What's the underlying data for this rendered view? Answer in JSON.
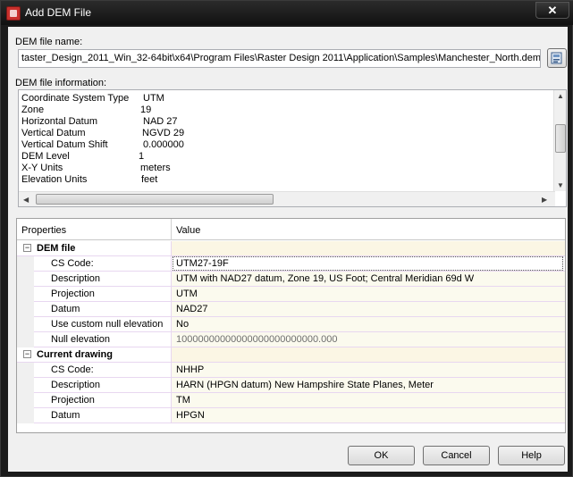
{
  "window": {
    "title": "Add DEM File",
    "close_glyph": "✕"
  },
  "dem_file_name": {
    "label": "DEM file name:",
    "value": "taster_Design_2011_Win_32-64bit\\x64\\Program Files\\Raster Design 2011\\Application\\Samples\\Manchester_North.dem",
    "browse_icon": "browse-icon"
  },
  "dem_file_information": {
    "label": "DEM file information:",
    "lines": [
      {
        "key": "Coordinate System Type",
        "value": "UTM"
      },
      {
        "key": "Zone",
        "value": "19"
      },
      {
        "key": "Horizontal Datum",
        "value": "NAD 27"
      },
      {
        "key": "Vertical Datum",
        "value": "NGVD 29"
      },
      {
        "key": "Vertical Datum Shift",
        "value": "0.000000"
      },
      {
        "key": "DEM Level",
        "value": "1"
      },
      {
        "key": "X-Y Units",
        "value": "meters"
      },
      {
        "key": "Elevation Units",
        "value": "feet"
      }
    ]
  },
  "grid": {
    "headers": {
      "properties": "Properties",
      "value": "Value"
    },
    "categories": [
      {
        "name": "DEM file",
        "expander": "−",
        "rows": [
          {
            "name": "CS Code:",
            "value": "UTM27-19F"
          },
          {
            "name": "Description",
            "value": "UTM with NAD27 datum, Zone 19, US Foot; Central Meridian 69d W"
          },
          {
            "name": "Projection",
            "value": "UTM"
          },
          {
            "name": "Datum",
            "value": "NAD27"
          },
          {
            "name": "Use custom null elevation",
            "value": "No"
          },
          {
            "name": "Null elevation",
            "value": "10000000000000000000000000.000"
          }
        ]
      },
      {
        "name": "Current drawing",
        "expander": "−",
        "rows": [
          {
            "name": "CS Code:",
            "value": "NHHP"
          },
          {
            "name": "Description",
            "value": "HARN (HPGN datum) New Hampshire State Planes, Meter"
          },
          {
            "name": "Projection",
            "value": "TM"
          },
          {
            "name": "Datum",
            "value": "HPGN"
          }
        ]
      }
    ]
  },
  "buttons": {
    "ok": "OK",
    "cancel": "Cancel",
    "help": "Help"
  }
}
